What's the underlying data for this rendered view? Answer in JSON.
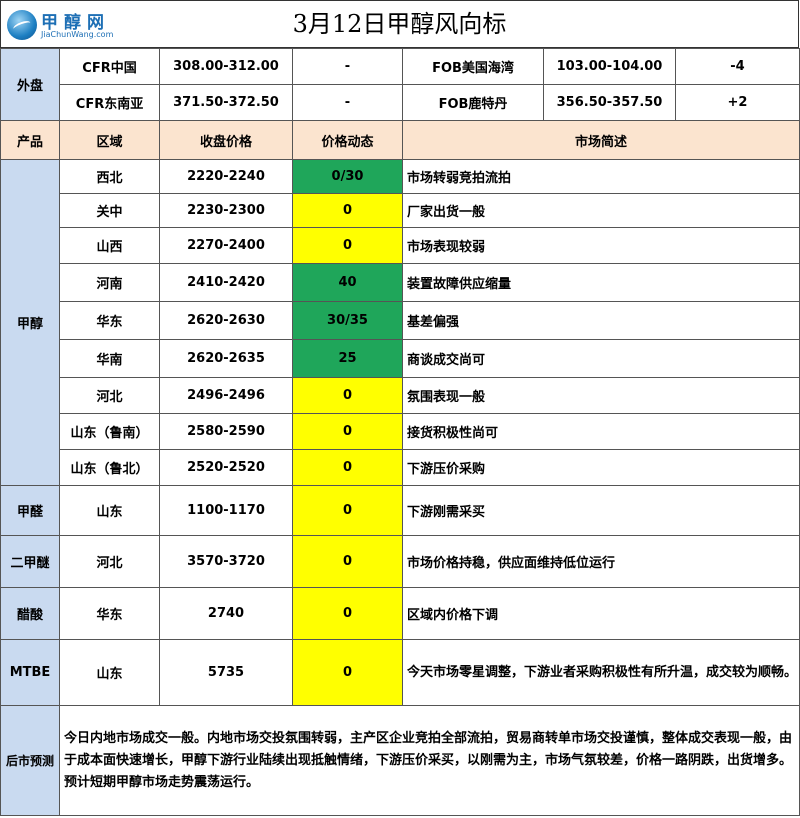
{
  "header": {
    "logo_text": "甲醇网",
    "logo_sub": "JiaChunWang.com",
    "title": "3月12日甲醇风向标"
  },
  "external": {
    "label": "外盘",
    "rows": [
      {
        "a_name": "CFR中国",
        "a_price": "308.00-312.00",
        "a_change": "-",
        "b_name": "FOB美国海湾",
        "b_price": "103.00-104.00",
        "b_change": "-4"
      },
      {
        "a_name": "CFR东南亚",
        "a_price": "371.50-372.50",
        "a_change": "-",
        "b_name": "FOB鹿特丹",
        "b_price": "356.50-357.50",
        "b_change": "+2"
      }
    ]
  },
  "columns": {
    "product": "产品",
    "region": "区域",
    "price": "收盘价格",
    "trend": "价格动态",
    "desc": "市场简述"
  },
  "methanol": {
    "label": "甲醇",
    "rows": [
      {
        "region": "西北",
        "price": "2220-2240",
        "trend": "0/30",
        "desc": "市场转弱竞拍流拍",
        "color": "#1fa65a"
      },
      {
        "region": "关中",
        "price": "2230-2300",
        "trend": "0",
        "desc": "厂家出货一般",
        "color": "#ffff00"
      },
      {
        "region": "山西",
        "price": "2270-2400",
        "trend": "0",
        "desc": "市场表现较弱",
        "color": "#ffff00"
      },
      {
        "region": "河南",
        "price": "2410-2420",
        "trend": "40",
        "desc": "装置故障供应缩量",
        "color": "#1fa65a"
      },
      {
        "region": "华东",
        "price": "2620-2630",
        "trend": "30/35",
        "desc": "基差偏强",
        "color": "#1fa65a"
      },
      {
        "region": "华南",
        "price": "2620-2635",
        "trend": "25",
        "desc": "商谈成交尚可",
        "color": "#1fa65a"
      },
      {
        "region": "河北",
        "price": "2496-2496",
        "trend": "0",
        "desc": "氛围表现一般",
        "color": "#ffff00"
      },
      {
        "region": "山东（鲁南）",
        "price": "2580-2590",
        "trend": "0",
        "desc": "接货积极性尚可",
        "color": "#ffff00"
      },
      {
        "region": "山东（鲁北）",
        "price": "2520-2520",
        "trend": "0",
        "desc": "下游压价采购",
        "color": "#ffff00"
      }
    ]
  },
  "others": [
    {
      "product": "甲醛",
      "region": "山东",
      "price": "1100-1170",
      "trend": "0",
      "desc": "下游刚需采买"
    },
    {
      "product": "二甲醚",
      "region": "河北",
      "price": "3570-3720",
      "trend": "0",
      "desc": "市场价格持稳，供应面维持低位运行"
    },
    {
      "product": "醋酸",
      "region": "华东",
      "price": "2740",
      "trend": "0",
      "desc": "区域内价格下调"
    },
    {
      "product": "MTBE",
      "region": "山东",
      "price": "5735",
      "trend": "0",
      "desc": "今天市场零星调整，下游业者采购积极性有所升温，成交较为顺畅。"
    }
  ],
  "forecast": {
    "label": "后市预测",
    "text": "今日内地市场成交一般。内地市场交投氛围转弱，主产区企业竞拍全部流拍，贸易商转单市场交投谨慎，整体成交表现一般，由于成本面快速增长，甲醇下游行业陆续出现抵触情绪，下游压价采买，以刚需为主，市场气氛较差，价格一路阴跌，出货增多。预计短期甲醇市场走势震荡运行。"
  }
}
